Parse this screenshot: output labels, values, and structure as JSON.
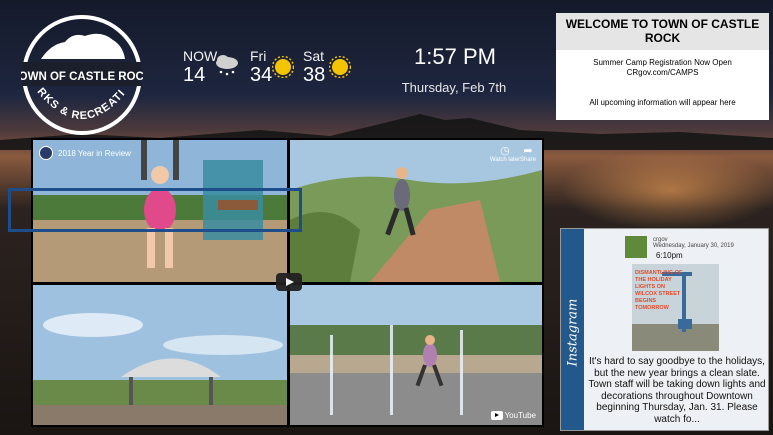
{
  "logo": {
    "line1": "TOWN OF CASTLE ROCK",
    "line2": "PARKS & RECREATION"
  },
  "weather": [
    {
      "label": "NOW",
      "temp": "14",
      "icon": "cloud-snow-icon"
    },
    {
      "label": "Fri",
      "temp": "34",
      "icon": "sun-icon"
    },
    {
      "label": "Sat",
      "temp": "38",
      "icon": "sun-icon"
    }
  ],
  "clock": {
    "time": "1:57 PM",
    "date": "Thursday, Feb 7th"
  },
  "welcome": {
    "title": "WELCOME TO TOWN OF CASTLE ROCK",
    "line1": "Summer Camp Registration Now Open",
    "line2": "CRgov.com/CAMPS",
    "line3": "All upcoming information will appear here"
  },
  "video": {
    "title": "2018 Year in Review",
    "watch_later": "Watch later",
    "share": "Share",
    "brand": "YouTube"
  },
  "instagram": {
    "label": "Instagram",
    "user": "crgov",
    "date": "Wednesday, January 30, 2019",
    "time": "6:10pm",
    "image_text": "DISMANTLING OF THE HOLIDAY LIGHTS ON WILCOX STREET BEGINS TOMORROW",
    "caption": "It's hard to say goodbye to the holidays, but the new year brings a clean slate. Town staff will be taking down lights and decorations throughout Downtown beginning Thursday, Jan. 31. Please watch fo..."
  },
  "colors": {
    "brand_blue": "#23588c",
    "sun": "#f5c400"
  }
}
